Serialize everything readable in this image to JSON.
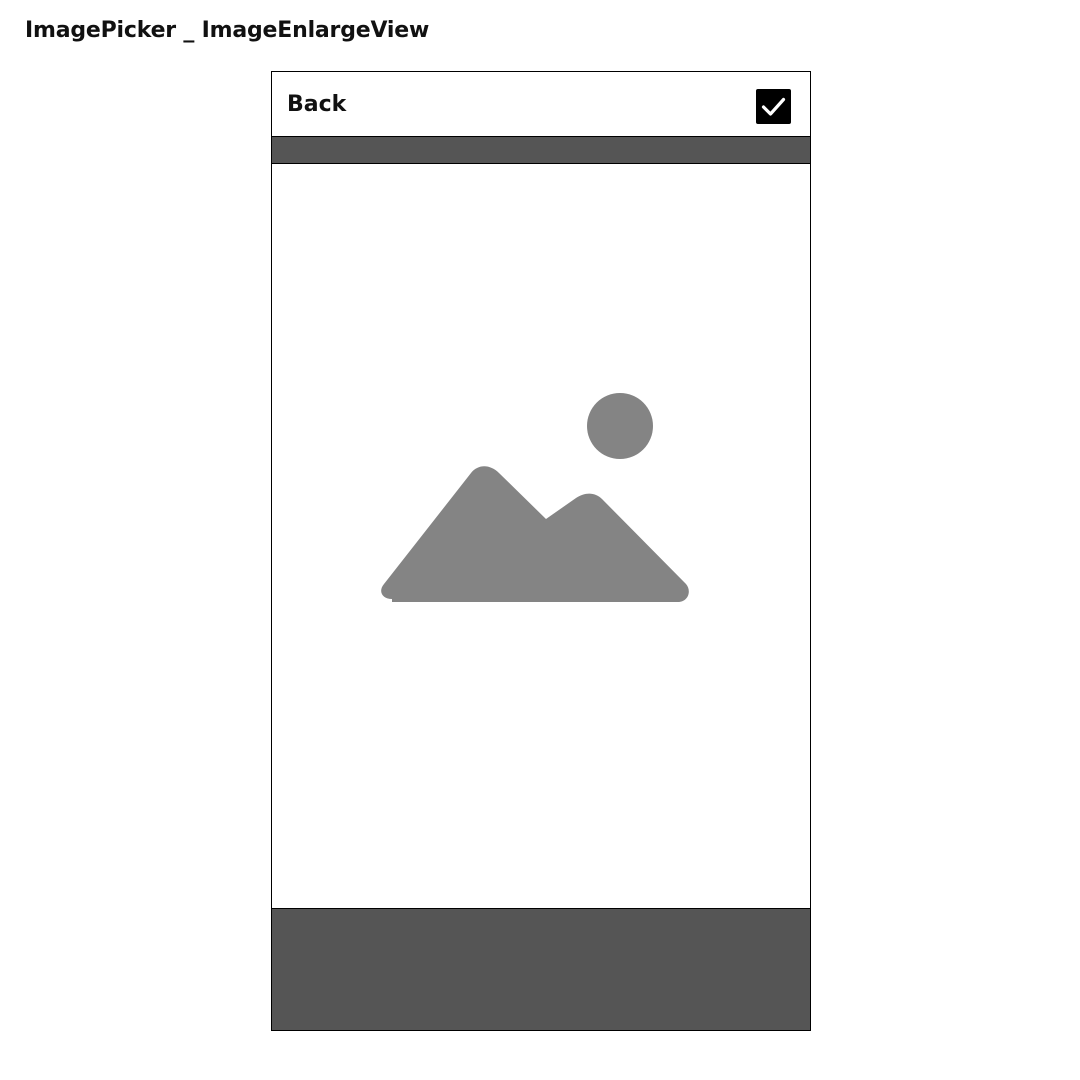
{
  "page": {
    "title": "ImagePicker _ ImageEnlargeView"
  },
  "header": {
    "back_label": "Back",
    "confirm_icon": "checkbox-checked-icon"
  },
  "image_view": {
    "placeholder_icon": "image-placeholder-icon"
  },
  "colors": {
    "bar_background": "#555555",
    "placeholder_gray": "#848484",
    "checkbox_fill": "#000000",
    "border": "#000000"
  }
}
